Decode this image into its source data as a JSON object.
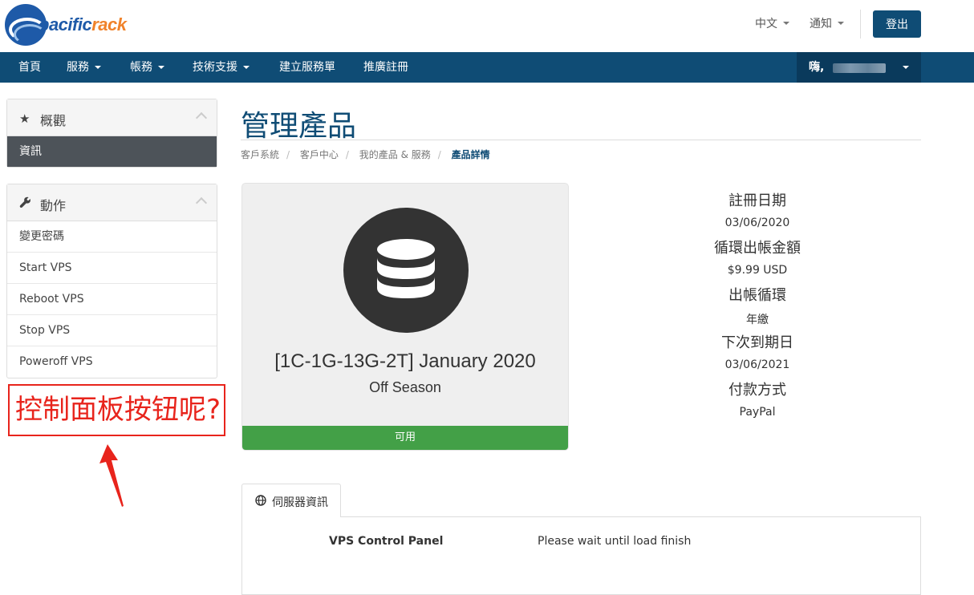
{
  "brand": {
    "logo_text_a": "pacific",
    "logo_text_b": "rack"
  },
  "top_links": {
    "language": "中文",
    "notifications": "通知",
    "logout": "登出"
  },
  "nav": {
    "items": [
      {
        "label": "首頁"
      },
      {
        "label": "服務"
      },
      {
        "label": "帳務"
      },
      {
        "label": "技術支援"
      },
      {
        "label": "建立服務單"
      },
      {
        "label": "推廣註冊"
      }
    ],
    "user_greeting": "嗨,"
  },
  "sidebar": {
    "overview": {
      "title": "概觀",
      "active_item": "資訊"
    },
    "actions": {
      "title": "動作",
      "items": [
        "變更密碼",
        "Start VPS",
        "Reboot VPS",
        "Stop VPS",
        "Poweroff VPS"
      ]
    }
  },
  "annotation": {
    "text": "控制面板按钮呢?",
    "color": "#e8241c"
  },
  "page": {
    "title": "管理產品",
    "breadcrumb": [
      "客戶系統",
      "客戶中心",
      "我的產品 & 服務",
      "產品詳情"
    ]
  },
  "product": {
    "name": "[1C-1G-13G-2T] January 2020",
    "subtitle": "Off Season",
    "status": "可用",
    "status_color": "#43a047",
    "icon": "database-icon"
  },
  "details": [
    {
      "label": "註冊日期",
      "value": "03/06/2020"
    },
    {
      "label": "循環出帳金額",
      "value": "$9.99 USD"
    },
    {
      "label": "出帳循環",
      "value": "年繳"
    },
    {
      "label": "下次到期日",
      "value": "03/06/2021"
    },
    {
      "label": "付款方式",
      "value": "PayPal"
    }
  ],
  "tabs": [
    {
      "label": "伺服器資訊",
      "icon": "globe-icon"
    }
  ],
  "server_info": {
    "key": "VPS Control Panel",
    "value": "Please wait until load finish"
  },
  "colors": {
    "brand_blue": "#0f4c75",
    "accent_orange": "#f0822a"
  }
}
